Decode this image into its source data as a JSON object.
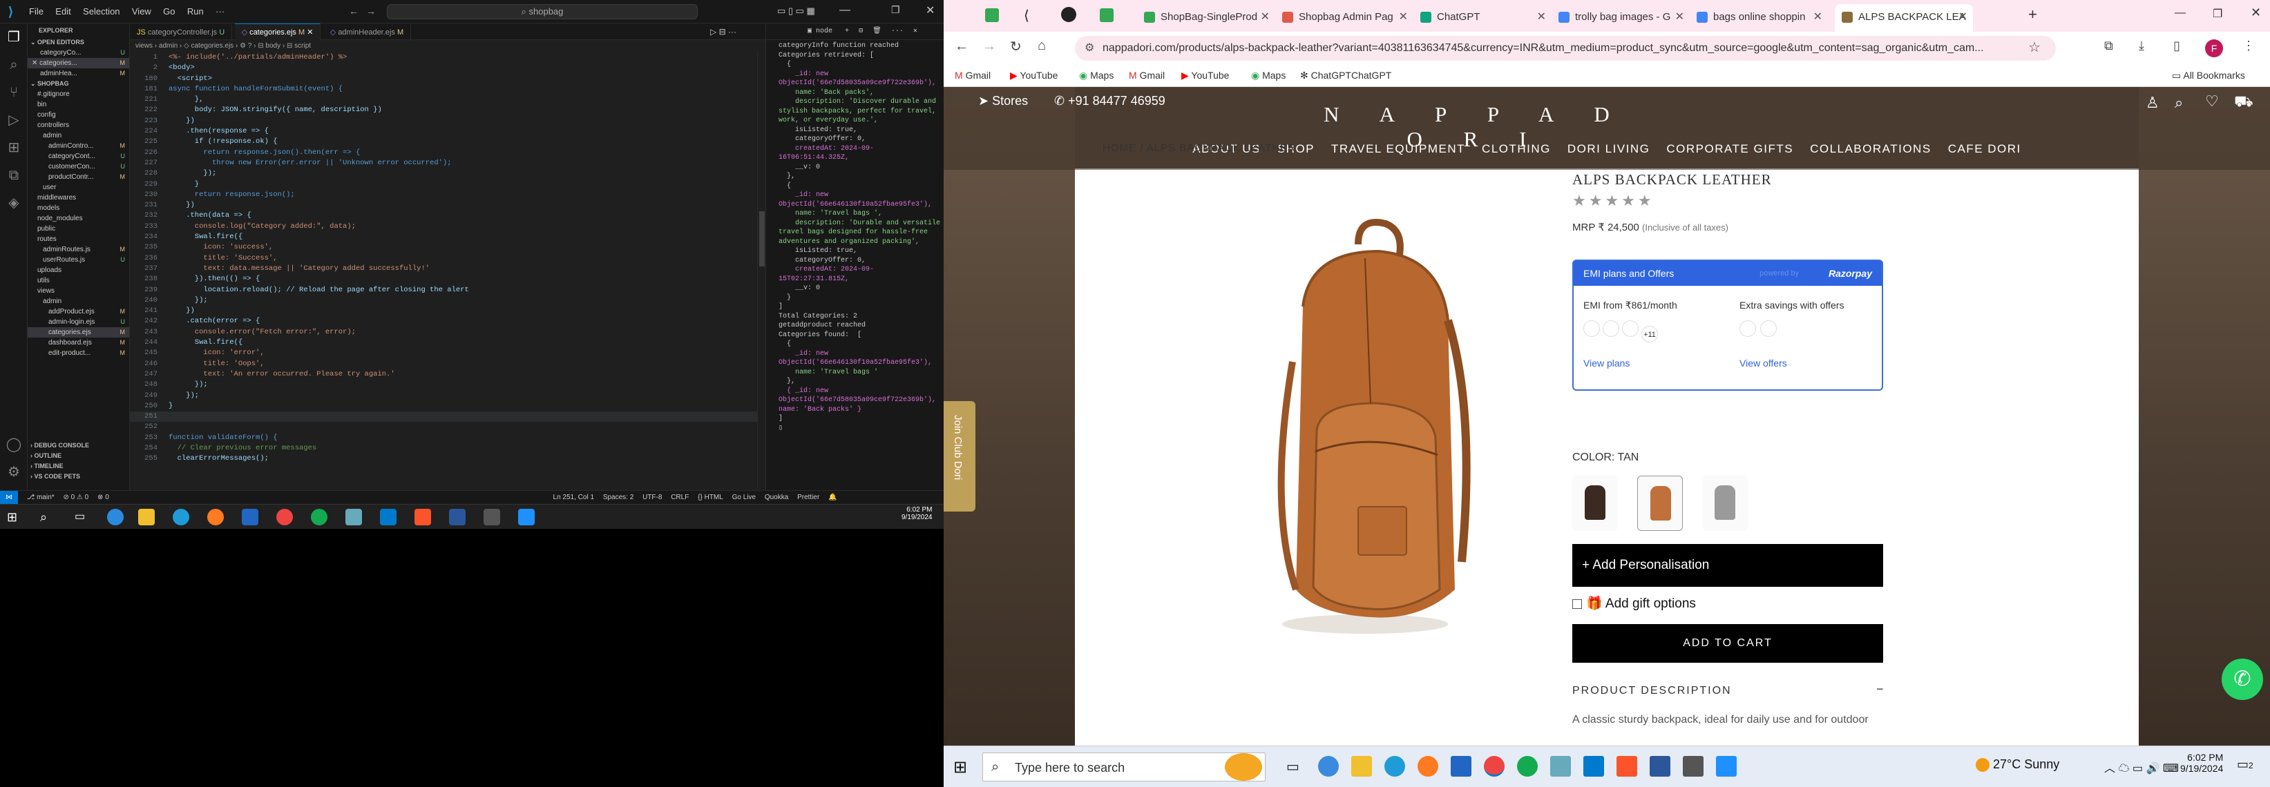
{
  "vscode": {
    "menu": [
      "File",
      "Edit",
      "Selection",
      "View",
      "Go",
      "Run"
    ],
    "search_placeholder": "shopbag",
    "explorer": {
      "title": "EXPLORER",
      "open_editors": "OPEN EDITORS",
      "open_files": [
        "categoryCo...",
        "categories...",
        "adminHea..."
      ],
      "project": "SHOPBAG",
      "tree": [
        "#.gitignore",
        "bin",
        "config",
        "controllers",
        "admin",
        "adminContro...",
        "categoryCont...",
        "customerCon...",
        "productContr...",
        "user",
        "middlewares",
        "models",
        "node_modules",
        "public",
        "routes",
        "adminRoutes.js",
        "userRoutes.js",
        "uploads",
        "utils",
        "views",
        "admin",
        "addProduct.ejs",
        "admin-login.ejs",
        "categories.ejs",
        "dashboard.ejs",
        "edit-product..."
      ],
      "bottom_sections": [
        "DEBUG CONSOLE",
        "OUTLINE",
        "TIMELINE",
        "VS CODE PETS"
      ]
    },
    "tabs": [
      "categoryController.js",
      "categories.ejs",
      "adminHeader.ejs"
    ],
    "breadcrumb": "views › admin › ◇ categories.ejs › ⚙ ? › ⊟ body › ⊟ script",
    "code": [
      [
        "1",
        "<%- include('../partials/adminHeader') %>"
      ],
      [
        "2",
        "<body>"
      ],
      [
        "180",
        "  <script>"
      ],
      [
        "181",
        "async function handleFormSubmit(event) {"
      ],
      [
        "221",
        "      },"
      ],
      [
        "222",
        "      body: JSON.stringify({ name, description })"
      ],
      [
        "223",
        "    })"
      ],
      [
        "224",
        "    .then(response => {"
      ],
      [
        "225",
        "      if (!response.ok) {"
      ],
      [
        "226",
        "        return response.json().then(err => {"
      ],
      [
        "227",
        "          throw new Error(err.error || 'Unknown error occurred');"
      ],
      [
        "228",
        "        });"
      ],
      [
        "229",
        "      }"
      ],
      [
        "230",
        "      return response.json();"
      ],
      [
        "231",
        "    })"
      ],
      [
        "232",
        "    .then(data => {"
      ],
      [
        "233",
        "      console.log(\"Category added:\", data);"
      ],
      [
        "234",
        "      Swal.fire({"
      ],
      [
        "235",
        "        icon: 'success',"
      ],
      [
        "236",
        "        title: 'Success',"
      ],
      [
        "237",
        "        text: data.message || 'Category added successfully!'"
      ],
      [
        "238",
        "      }).then(() => {"
      ],
      [
        "239",
        "        location.reload(); // Reload the page after closing the alert"
      ],
      [
        "240",
        "      });"
      ],
      [
        "241",
        "    })"
      ],
      [
        "242",
        "    .catch(error => {"
      ],
      [
        "243",
        "      console.error(\"Fetch error:\", error);"
      ],
      [
        "244",
        "      Swal.fire({"
      ],
      [
        "245",
        "        icon: 'error',"
      ],
      [
        "246",
        "        title: 'Oops',"
      ],
      [
        "247",
        "        text: 'An error occurred. Please try again.'"
      ],
      [
        "248",
        "      });"
      ],
      [
        "249",
        "    });"
      ],
      [
        "250",
        "}"
      ],
      [
        "251",
        ""
      ],
      [
        "252",
        ""
      ],
      [
        "253",
        "function validateForm() {"
      ],
      [
        "254",
        "  // Clear previous error messages"
      ],
      [
        "255",
        "  clearErrorMessages();"
      ]
    ],
    "terminal": [
      "categoryInfo function reached",
      "Categories retrieved: [",
      "  {",
      "    _id: new ObjectId('66e7d58035a09ce9f722e369b'),",
      "    name: 'Back packs',",
      "    description: 'Discover durable and stylish backpacks, perfect for travel, work, or everyday use.',",
      "    isListed: true,",
      "    categoryOffer: 0,",
      "    createdAt: 2024-09-16T06:51:44.325Z,",
      "    __v: 0",
      "  },",
      "  {",
      "    _id: new ObjectId('66e646130f10a52fbae95fe3'),",
      "    name: 'Travel bags ',",
      "    description: 'Durable and versatile travel bags designed for hassle-free adventures and organized packing',",
      "    isListed: true,",
      "    categoryOffer: 0,",
      "    createdAt: 2024-09-15T02:27:31.815Z,",
      "    __v: 0",
      "  }",
      "]",
      "Total Categories: 2",
      "getaddproduct reached",
      "Categories found:  [",
      "  {",
      "    _id: new ObjectId('66e646130f10a52fbae95fe3'),",
      "    name: 'Travel bags '",
      "  },",
      "  { _id: new ObjectId('66e7d58035a09ce9f722e369b'), name: 'Back packs' }",
      "]",
      "▯"
    ],
    "status": [
      "⎇ main*",
      "⊘ 0 ⚠ 0",
      "⊗ 0",
      "Ln 251, Col 1",
      "Spaces: 2",
      "UTF-8",
      "CRLF",
      "{} HTML",
      "Go Live",
      "Quokka",
      "Prettier"
    ],
    "taskbar_time": "6:02 PM",
    "taskbar_date": "9/19/2024"
  },
  "chrome": {
    "tabs": [
      {
        "label": "ShopBag-SingleProd",
        "color": "#34a853"
      },
      {
        "label": "Shopbag Admin Pag",
        "color": "#e05a4a"
      },
      {
        "label": "ChatGPT",
        "color": "#10a37f"
      },
      {
        "label": "trolly bag images - G",
        "color": "#4285f4"
      },
      {
        "label": "bags online shoppin",
        "color": "#4285f4"
      },
      {
        "label": "ALPS BACKPACK LEA",
        "color": "#8a6d3b"
      }
    ],
    "url": "nappadori.com/products/alps-backpack-leather?variant=40381163634745&currency=INR&utm_medium=product_sync&utm_source=google&utm_content=sag_organic&utm_cam...",
    "bookmarks": [
      "Gmail",
      "YouTube",
      "Maps",
      "Gmail",
      "YouTube",
      "Maps",
      "ChatGPTChatGPT"
    ],
    "all_bookmarks": "All Bookmarks",
    "profile_initial": "F"
  },
  "site": {
    "stores": "Stores",
    "phone": "+91 84477 46959",
    "logo": "N A P P A   D O R I",
    "nav": [
      "ABOUT US",
      "SHOP",
      "TRAVEL EQUIPMENT",
      "CLOTHING",
      "DORI LIVING",
      "CORPORATE GIFTS",
      "COLLABORATIONS",
      "CAFE DORI"
    ],
    "breadcrumb_overlay": "HOME / ALPS BACKPACK LEATHER",
    "product_title": "ALPS BACKPACK LEATHER",
    "stars": "★★★★★",
    "mrp_label": "MRP",
    "price": "₹ 24,500",
    "tax_note": "(Inclusive of all taxes)",
    "emi_header": "EMI plans and Offers",
    "emi_powered": "powered by",
    "emi_brand": "Razorpay",
    "emi_from": "EMI from ₹861/month",
    "emi_more": "+11",
    "view_plans": "View plans",
    "savings": "Extra savings with offers",
    "view_offers": "View offers",
    "color_label": "COLOR: TAN",
    "swatches": [
      "#3a2a22",
      "#c0703a",
      "#9a9a9a"
    ],
    "add_personalisation": "+ Add Personalisation",
    "gift_options": "Add gift options",
    "add_to_cart": "ADD TO CART",
    "product_description": "PRODUCT DESCRIPTION",
    "desc_minus": "−",
    "desc_text": "A classic sturdy backpack, ideal for daily use and for outdoor",
    "join_club": "Join Club Dori"
  },
  "taskbar": {
    "search_placeholder": "Type here to search",
    "weather": "27°C  Sunny",
    "time": "6:02 PM",
    "date": "9/19/2024",
    "notifications": "2"
  },
  "colors": {
    "vscode_bg": "#1f1f1f",
    "accent": "#0078d4",
    "chrome_tab_strip": "#fde7f0",
    "razorpay_blue": "#2e64e0",
    "bag_tan": "#b8682e"
  }
}
